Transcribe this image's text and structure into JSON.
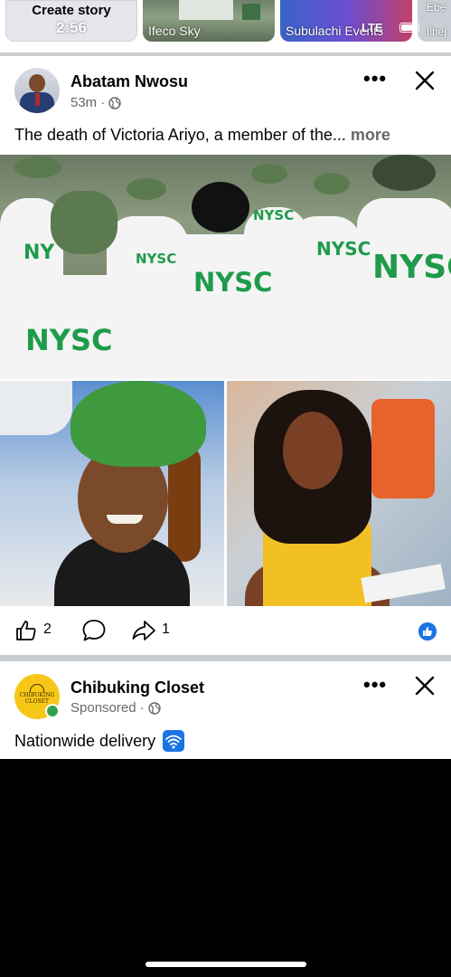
{
  "status_bar": {
    "time": "2:56",
    "network": "LTE"
  },
  "stories": [
    {
      "label": "Create story",
      "kind": "create"
    },
    {
      "label": "Ifeco Sky"
    },
    {
      "label": "Subulachi Events"
    },
    {
      "label_top": "Ebe",
      "label": "Ilhej"
    }
  ],
  "post": {
    "author": "Abatam Nwosu",
    "time": "53m",
    "separator": "·",
    "text": "The death of Victoria Ariyo, a member of the...",
    "more_label": "more",
    "photo_main_labels": [
      "NYSC",
      "NYSC",
      "NYSC",
      "NYSC",
      "NYSC",
      "NY",
      "NYSC"
    ],
    "like_count": "2",
    "share_count": "1"
  },
  "ad": {
    "name": "Chibuking Closet",
    "sponsored": "Sponsored",
    "separator": "·",
    "text": "Nationwide delivery",
    "logo_text": "CHIBUKING CLOSET"
  },
  "colors": {
    "accent": "#1b74e4",
    "online": "#31a24c",
    "nysc_green": "#1f9b4b",
    "muted": "#65676b"
  },
  "icons": [
    "globe-icon",
    "more-icon",
    "close-icon",
    "like-icon",
    "comment-icon",
    "share-icon",
    "like-badge-icon",
    "wifi-icon"
  ]
}
